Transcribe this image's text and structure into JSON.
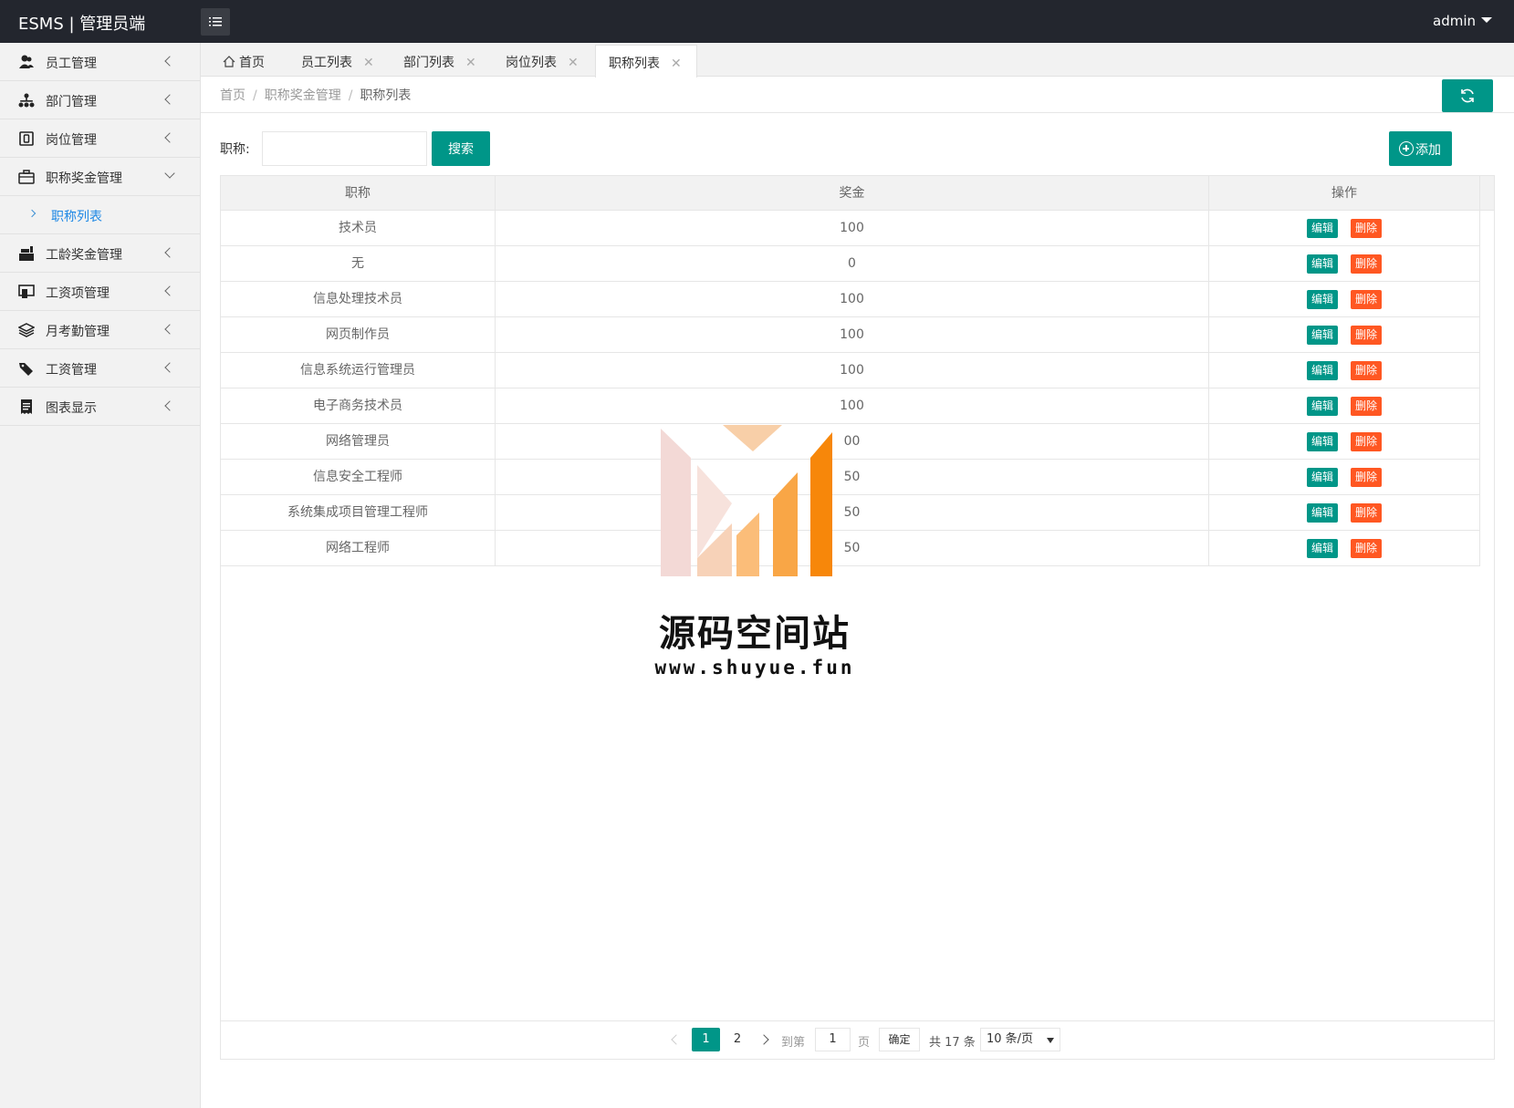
{
  "app": {
    "title": "ESMS | 管理员端",
    "user": "admin"
  },
  "sidebar": {
    "items": [
      {
        "label": "员工管理",
        "icon": "users-icon"
      },
      {
        "label": "部门管理",
        "icon": "sitemap-icon"
      },
      {
        "label": "岗位管理",
        "icon": "badge-icon"
      },
      {
        "label": "职称奖金管理",
        "icon": "briefcase-icon"
      },
      {
        "label": "工龄奖金管理",
        "icon": "cash-register-icon"
      },
      {
        "label": "工资项管理",
        "icon": "monitor-icon"
      },
      {
        "label": "月考勤管理",
        "icon": "layers-icon"
      },
      {
        "label": "工资管理",
        "icon": "tags-icon"
      },
      {
        "label": "图表显示",
        "icon": "receipt-icon"
      }
    ],
    "sub_item": "职称列表"
  },
  "tabs": [
    {
      "label": "首页"
    },
    {
      "label": "员工列表"
    },
    {
      "label": "部门列表"
    },
    {
      "label": "岗位列表"
    },
    {
      "label": "职称列表"
    }
  ],
  "breadcrumb": [
    "首页",
    "职称奖金管理",
    "职称列表"
  ],
  "search": {
    "label": "职称:",
    "value": "",
    "button": "搜索"
  },
  "add_button": "添加",
  "table": {
    "headers": [
      "职称",
      "奖金",
      "操作"
    ],
    "edit_label": "编辑",
    "delete_label": "删除",
    "rows": [
      {
        "title": "技术员",
        "bonus": "100"
      },
      {
        "title": "无",
        "bonus": "0"
      },
      {
        "title": "信息处理技术员",
        "bonus": "100"
      },
      {
        "title": "网页制作员",
        "bonus": "100"
      },
      {
        "title": "信息系统运行管理员",
        "bonus": "100"
      },
      {
        "title": "电子商务技术员",
        "bonus": "100"
      },
      {
        "title": "网络管理员",
        "bonus": "00"
      },
      {
        "title": "信息安全工程师",
        "bonus": "50"
      },
      {
        "title": "系统集成项目管理工程师",
        "bonus": "50"
      },
      {
        "title": "网络工程师",
        "bonus": "50"
      }
    ]
  },
  "pager": {
    "current": "1",
    "next_page": "2",
    "goto_label": "到第",
    "goto_value": "1",
    "page_label": "页",
    "confirm": "确定",
    "total": "共 17 条",
    "page_size": "10 条/页"
  },
  "watermark": {
    "title": "源码空间站",
    "url": "www.shuyue.fun"
  },
  "colors": {
    "primary": "#009688",
    "danger": "#ff5722",
    "topbar": "#23262e",
    "link": "#1e88e5"
  }
}
